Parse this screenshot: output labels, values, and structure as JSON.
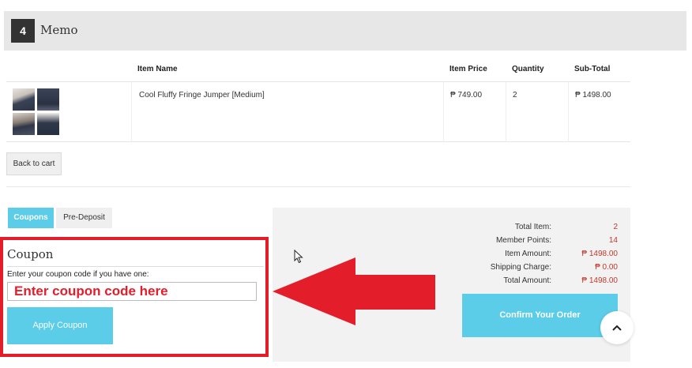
{
  "memo": {
    "number": "4",
    "title": "Memo"
  },
  "table": {
    "headers": [
      "Item Name",
      "Item Price",
      "Quantity",
      "Sub-Total"
    ],
    "rows": [
      {
        "name": "Cool Fluffy Fringe Jumper [Medium]",
        "price": "₱ 749.00",
        "quantity": "2",
        "subtotal": "₱ 1498.00"
      }
    ]
  },
  "back_button": "Back to cart",
  "tabs": [
    "Coupons",
    "Pre-Deposit"
  ],
  "coupon": {
    "title": "Coupon",
    "label": "Enter your coupon code if you have one:",
    "placeholder": "Enter coupon code here",
    "apply_button": "Apply Coupon"
  },
  "summary": {
    "items": [
      {
        "label": "Total Item:",
        "value": "2"
      },
      {
        "label": "Member Points:",
        "value": "14"
      },
      {
        "label": "Item Amount:",
        "value": "₱ 1498.00"
      },
      {
        "label": "Shipping Charge:",
        "value": "₱ 0.00"
      },
      {
        "label": "Total Amount:",
        "value": "₱ 1498.00"
      }
    ],
    "confirm_button": "Confirm Your Order"
  },
  "icons": {
    "scroll_top": "chevron-up-icon",
    "annotation": "red-arrow-icon",
    "cursor": "mouse-pointer-icon"
  },
  "colors": {
    "accent": "#5bcde8",
    "annotation_red": "#e41d2b",
    "price_red": "#c0392b"
  }
}
